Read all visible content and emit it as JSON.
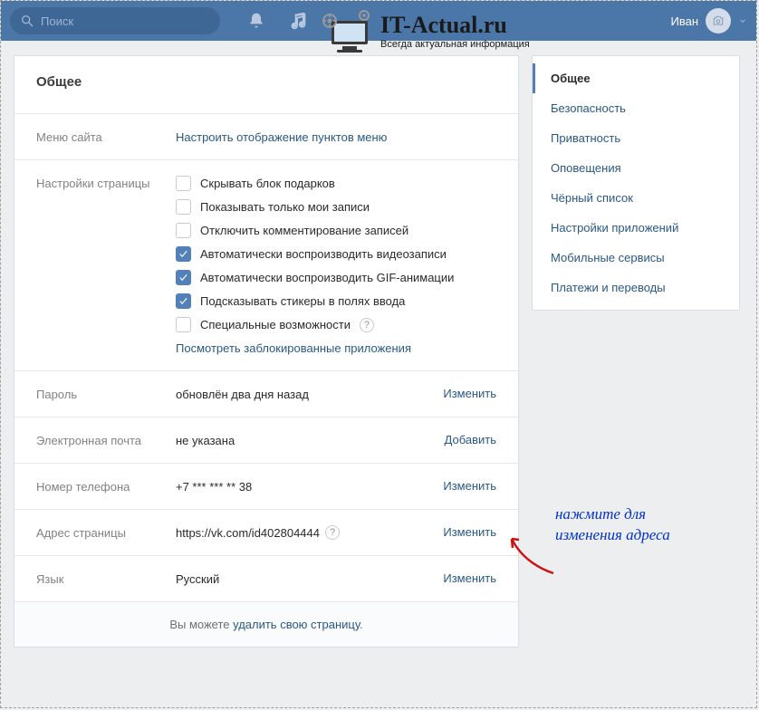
{
  "header": {
    "search_placeholder": "Поиск",
    "username": "Иван"
  },
  "logo": {
    "main": "IT-Actual.ru",
    "sub": "Всегда актуальная информация"
  },
  "page_title": "Общее",
  "rows": {
    "site_menu": {
      "label": "Меню сайта",
      "action": "Настроить отображение пунктов меню"
    },
    "page_settings": {
      "label": "Настройки страницы"
    },
    "password": {
      "label": "Пароль",
      "value": "обновлён два дня назад",
      "action": "Изменить"
    },
    "email": {
      "label": "Электронная почта",
      "value": "не указана",
      "action": "Добавить"
    },
    "phone": {
      "label": "Номер телефона",
      "value": "+7 *** *** ** 38",
      "action": "Изменить"
    },
    "address": {
      "label": "Адрес страницы",
      "value": "https://vk.com/id402804444",
      "action": "Изменить"
    },
    "language": {
      "label": "Язык",
      "value": "Русский",
      "action": "Изменить"
    }
  },
  "checkboxes": [
    {
      "label": "Скрывать блок подарков",
      "checked": false
    },
    {
      "label": "Показывать только мои записи",
      "checked": false
    },
    {
      "label": "Отключить комментирование записей",
      "checked": false
    },
    {
      "label": "Автоматически воспроизводить видеозаписи",
      "checked": true
    },
    {
      "label": "Автоматически воспроизводить GIF-анимации",
      "checked": true
    },
    {
      "label": "Подсказывать стикеры в полях ввода",
      "checked": true
    },
    {
      "label": "Специальные возможности",
      "checked": false,
      "help": true
    }
  ],
  "blocked_apps_link": "Посмотреть заблокированные приложения",
  "footer": {
    "prefix": "Вы можете ",
    "link": "удалить свою страницу",
    "suffix": "."
  },
  "sidebar": {
    "items": [
      {
        "label": "Общее",
        "active": true
      },
      {
        "label": "Безопасность"
      },
      {
        "label": "Приватность"
      },
      {
        "label": "Оповещения"
      },
      {
        "label": "Чёрный список"
      },
      {
        "label": "Настройки приложений"
      },
      {
        "label": "Мобильные сервисы"
      },
      {
        "label": "Платежи и переводы"
      }
    ]
  },
  "annotation": {
    "line1": "нажмите для",
    "line2": "изменения адреса"
  }
}
